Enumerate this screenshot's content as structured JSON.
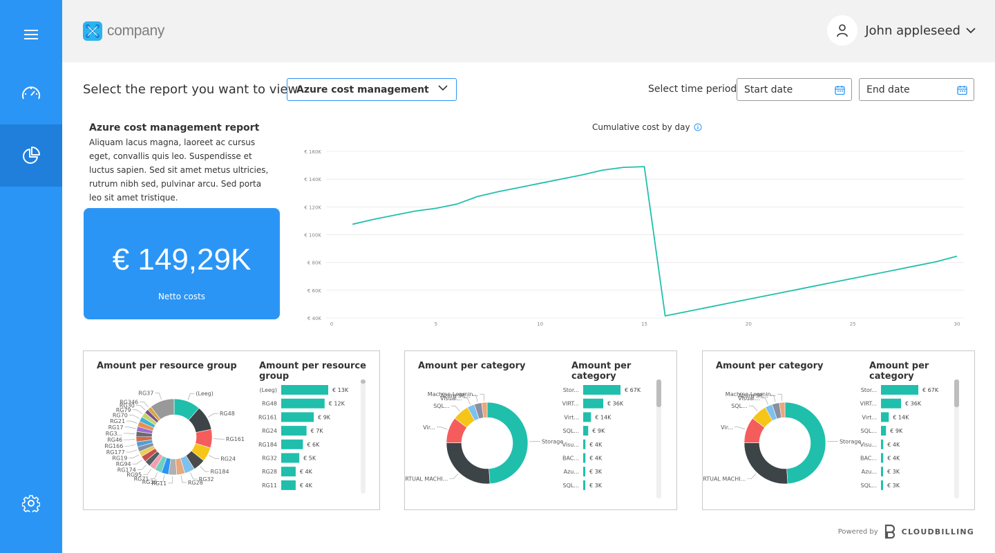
{
  "brand": {
    "name": "company"
  },
  "user": {
    "name": "John appleseed"
  },
  "sidebar": {
    "items": [
      {
        "icon": "menu-icon"
      },
      {
        "icon": "speedometer-icon"
      },
      {
        "icon": "pie-chart-icon",
        "active": true
      },
      {
        "icon": "gear-icon"
      }
    ],
    "colors": {
      "bg": "#2b95f5",
      "active": "#1f7fda"
    }
  },
  "controls": {
    "report_label": "Select the report you want to view",
    "report_selected": "Azure cost management",
    "period_label": "Select time period",
    "start_placeholder": "Start date",
    "end_placeholder": "End date"
  },
  "report": {
    "title": "Azure cost management report",
    "description": "Aliquam lacus magna, laoreet ac cursus eget, convallis quis leo. Suspendisse et luctus sapien. Sed sit amet metus ultricies, rutrum nibh sed, pulvinar arcu. Sed porta leo sit amet tristique."
  },
  "kpi": {
    "value": "€ 149,29K",
    "label": "Netto costs"
  },
  "footer": {
    "powered_by": "Powered by",
    "brand": "CLOUDBILLING"
  },
  "chart_data": [
    {
      "type": "line",
      "title": "Cumulative cost by day",
      "x": [
        1,
        2,
        3,
        4,
        5,
        6,
        7,
        8,
        9,
        10,
        11,
        12,
        13,
        14,
        15,
        16,
        17,
        18,
        19,
        20,
        21,
        22,
        23,
        24,
        25,
        26,
        27,
        28,
        29,
        30
      ],
      "values": [
        107.5,
        111,
        114,
        117,
        119,
        122,
        127.5,
        131,
        134,
        137,
        140,
        143,
        146.5,
        148.5,
        149,
        41.5,
        44.5,
        47.5,
        50.5,
        53.5,
        56.5,
        59.5,
        62.5,
        65.5,
        68.5,
        71.5,
        74.5,
        77.5,
        80.5,
        84.5
      ],
      "xticks": [
        0,
        5,
        10,
        15,
        20,
        25,
        30
      ],
      "yticks": [
        "€ 40K",
        "€ 60K",
        "€ 80K",
        "€ 100K",
        "€ 120K",
        "€ 140K",
        "€ 160K"
      ],
      "ylim": [
        40,
        160
      ],
      "xlim": [
        0,
        30
      ],
      "grid": true,
      "color": "#1fbfac"
    },
    {
      "type": "pie",
      "title": "Amount per resource group",
      "labels": [
        "(Leeg)",
        "RG48",
        "RG161",
        "RG24",
        "RG184",
        "RG32",
        "RG28",
        "RG11",
        "RG36",
        "RG71",
        "RG95",
        "RG174",
        "RG94",
        "RG19",
        "RG177",
        "RG166",
        "RG46",
        "RG3...",
        "RG17",
        "RG21",
        "RG70",
        "RG79",
        "RG30",
        "RG346",
        "RG37"
      ],
      "values": [
        13,
        12,
        9,
        7,
        6,
        5,
        4,
        4,
        3.5,
        3.5,
        3,
        3,
        3,
        2.5,
        2.5,
        2.5,
        2.5,
        2.5,
        2.5,
        2.5,
        2.5,
        2.5,
        2,
        2,
        12
      ],
      "colors": [
        "#1fbfac",
        "#3d4447",
        "#f55c5c",
        "#f5c518",
        "#4a4a4a",
        "#7ec0ee",
        "#e8a87c",
        "#b0b0b0",
        "#2b95f5",
        "#6fcfc0",
        "#f0a0b0",
        "#555f66",
        "#c94f4f",
        "#e6cf5a",
        "#8a8fa0",
        "#4fa0d8",
        "#d36b4c",
        "#6a6a6a",
        "#9b6fd3",
        "#ec8d4b",
        "#40b3d8",
        "#c4d66e",
        "#7a4f8f",
        "#d9a441",
        "#999999"
      ]
    },
    {
      "type": "bar",
      "title": "Amount per resource group",
      "categories": [
        "(Leeg)",
        "RG48",
        "RG161",
        "RG24",
        "RG184",
        "RG32",
        "RG28",
        "RG11"
      ],
      "values": [
        13,
        12,
        9,
        7,
        6,
        5,
        4,
        4
      ],
      "labels": [
        "€ 13K",
        "€ 12K",
        "€ 9K",
        "€ 7K",
        "€ 6K",
        "€ 5K",
        "€ 4K",
        "€ 4K"
      ],
      "color": "#1fbfac"
    },
    {
      "type": "pie",
      "title": "Amount per category",
      "labels": [
        "Storage",
        "VIRTUAL MACHI...",
        "Vir...",
        "SQL...",
        "Visual...",
        "Azure Sit...",
        "Machine Learnin..."
      ],
      "values": [
        67,
        36,
        14,
        9,
        4,
        4,
        3
      ],
      "colors": [
        "#1fbfac",
        "#3d4447",
        "#f55c5c",
        "#f5c518",
        "#7ec0ee",
        "#8a8fa0",
        "#e8a87c"
      ]
    },
    {
      "type": "bar",
      "title": "Amount per category",
      "categories": [
        "Stor...",
        "VIRT...",
        "Virt...",
        "SQL...",
        "Visu...",
        "BAC...",
        "Azu...",
        "SQL..."
      ],
      "values": [
        67,
        36,
        14,
        9,
        4,
        4,
        3,
        3
      ],
      "labels": [
        "€ 67K",
        "€ 36K",
        "€ 14K",
        "€ 9K",
        "€ 4K",
        "€ 4K",
        "€ 3K",
        "€ 3K"
      ],
      "color": "#1fbfac"
    },
    {
      "type": "pie",
      "title": "Amount per category",
      "labels": [
        "Storage",
        "VIRTUAL MACHI...",
        "Vir...",
        "SQL...",
        "Visual...",
        "Azure Sit...",
        "Machine Learnin..."
      ],
      "values": [
        67,
        36,
        14,
        9,
        4,
        4,
        3
      ],
      "colors": [
        "#1fbfac",
        "#3d4447",
        "#f55c5c",
        "#f5c518",
        "#7ec0ee",
        "#8a8fa0",
        "#e8a87c"
      ]
    },
    {
      "type": "bar",
      "title": "Amount per category",
      "categories": [
        "Stor...",
        "VIRT...",
        "Virt...",
        "SQL...",
        "Visu...",
        "BAC...",
        "Azu...",
        "SQL..."
      ],
      "values": [
        67,
        36,
        14,
        9,
        4,
        4,
        3,
        3
      ],
      "labels": [
        "€ 67K",
        "€ 36K",
        "€ 14K",
        "€ 9K",
        "€ 4K",
        "€ 4K",
        "€ 3K",
        "€ 3K"
      ],
      "color": "#1fbfac"
    }
  ]
}
